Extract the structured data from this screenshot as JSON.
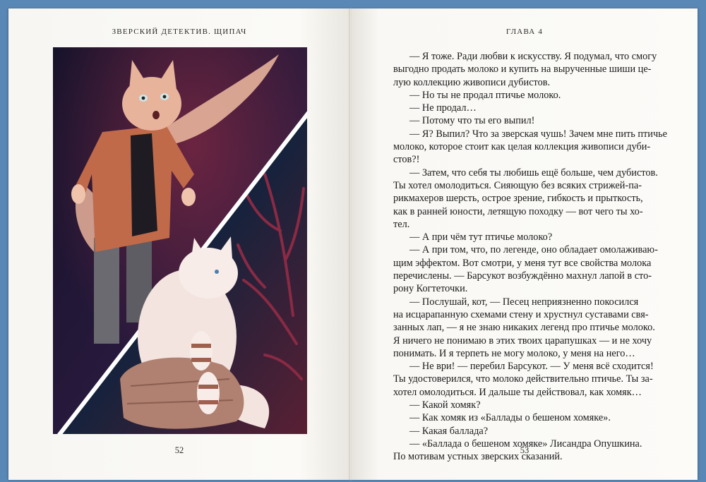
{
  "left_page": {
    "running_head": "ЗВЕРСКИЙ ДЕТЕКТИВ. ЩИПАЧ",
    "page_number": "52"
  },
  "right_page": {
    "running_head": "ГЛАВА 4",
    "page_number": "53",
    "lines": [
      {
        "text": "— Я тоже. Ради любви к искусству. Я подумал, что смогу",
        "indent": true
      },
      {
        "text": "выгодно продать молоко и купить на вырученные шиши це-",
        "indent": false
      },
      {
        "text": "лую коллекцию живописи дубистов.",
        "indent": false
      },
      {
        "text": "— Но ты не продал птичье молоко.",
        "indent": true
      },
      {
        "text": "— Не продал…",
        "indent": true
      },
      {
        "text": "— Потому что ты его выпил!",
        "indent": true
      },
      {
        "text": "— Я? Выпил? Что за зверская чушь! Зачем мне пить птичье",
        "indent": true
      },
      {
        "text": "молоко, которое стоит как целая коллекция живописи дуби-",
        "indent": false
      },
      {
        "text": "стов?!",
        "indent": false
      },
      {
        "text": "— Затем, что себя ты любишь ещё больше, чем дубистов.",
        "indent": true
      },
      {
        "text": "Ты хотел омолодиться. Сияющую без всяких стрижей-па-",
        "indent": false
      },
      {
        "text": "рикмахеров шерсть, острое зрение, гибкость и прыткость,",
        "indent": false
      },
      {
        "text": "как в ранней юности, летящую походку — вот чего ты хо-",
        "indent": false
      },
      {
        "text": "тел.",
        "indent": false
      },
      {
        "text": "— А при чём тут птичье молоко?",
        "indent": true
      },
      {
        "text": "— А при том, что, по легенде, оно обладает омолаживаю-",
        "indent": true
      },
      {
        "text": "щим эффектом. Вот смотри, у меня тут все свойства молока",
        "indent": false
      },
      {
        "text": "перечислены. — Барсукот возбуждённо махнул лапой в сто-",
        "indent": false
      },
      {
        "text": "рону Когтеточки.",
        "indent": false
      },
      {
        "text": "— Послушай, кот, — Песец неприязненно покосился",
        "indent": true
      },
      {
        "text": "на исцарапанную схемами стену и хрустнул суставами свя-",
        "indent": false
      },
      {
        "text": "занных лап, — я не знаю никаких легенд про птичье молоко.",
        "indent": false
      },
      {
        "text": "Я ничего не понимаю в этих твоих царапушках — и не хочу",
        "indent": false
      },
      {
        "text": "понимать. И я терпеть не могу молоко, у меня на него…",
        "indent": false
      },
      {
        "text": "— Не ври! — перебил Барсукот. — У меня всё сходится!",
        "indent": true
      },
      {
        "text": "Ты удостоверился, что молоко действительно птичье. Ты за-",
        "indent": false
      },
      {
        "text": "хотел омолодиться. И дальше ты действовал, как хомяк…",
        "indent": false
      },
      {
        "text": "— Какой хомяк?",
        "indent": true
      },
      {
        "text": "— Как хомяк из «Баллады о бешеном хомяке».",
        "indent": true
      },
      {
        "text": "— Какая баллада?",
        "indent": true
      },
      {
        "text": "— «Баллада о бешеном хомяке» Лисандра Опушкина.",
        "indent": true
      },
      {
        "text": "По мотивам устных зверских сказаний.",
        "indent": false
      }
    ]
  },
  "colors": {
    "background": "#5a88b6",
    "paper": "#fbfaf7",
    "ink": "#1a1a1a",
    "illustration_top": "#1f1838",
    "illustration_bottom": "#1b2a4a",
    "cat_fur": "#e7b39b",
    "cat_jacket": "#c06a4a",
    "fox_fur": "#f3e4e0"
  }
}
